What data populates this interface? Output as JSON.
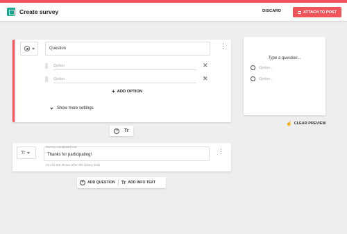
{
  "header": {
    "title": "Create survey",
    "discard_label": "DISCARD",
    "attach_label": "ATTACH TO POST",
    "accent_color": "#f0555b",
    "app_icon": "survey-app-icon"
  },
  "question_card": {
    "type_icon": "radio-button-icon",
    "question_value": "Question",
    "options": [
      {
        "placeholder": "Option"
      },
      {
        "placeholder": "Option"
      }
    ],
    "add_option_label": "ADD OPTION",
    "more_settings_label": "Show more settings"
  },
  "info_card": {
    "type_icon": "text-format-icon",
    "type_label": "Tr",
    "field_label": "Survey completed text",
    "value": "Thanks for participating!",
    "help_text": "An info text shown when the survey ends"
  },
  "mini_toolbar": {
    "add_icon": "add-circle-icon",
    "text_label": "Tr"
  },
  "bottom_actions": {
    "add_question_label": "ADD QUESTION",
    "add_info_label": "ADD INFO TEXT",
    "add_info_glyph": "Tr"
  },
  "preview": {
    "question_placeholder": "Type a question...",
    "options": [
      "Option...",
      "Option..."
    ],
    "clear_label": "CLEAR PREVIEW"
  }
}
